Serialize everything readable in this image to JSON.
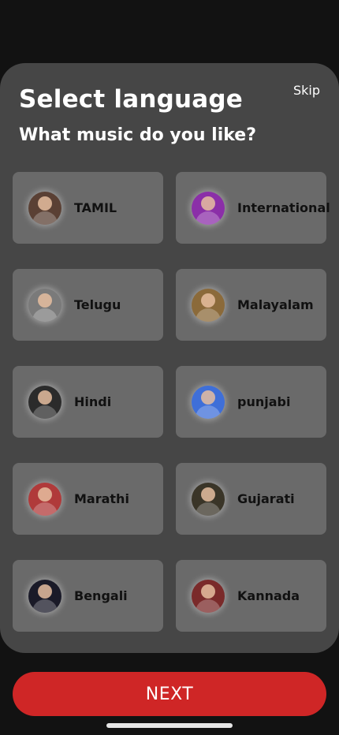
{
  "header": {
    "title": "Select language",
    "skip_label": "Skip",
    "subtitle": "What music do you like?"
  },
  "languages": [
    {
      "label": "TAMIL",
      "avatar_color": "#5a4034"
    },
    {
      "label": "International",
      "avatar_color": "#8b2fa8"
    },
    {
      "label": "Telugu",
      "avatar_color": "#7a7a7a"
    },
    {
      "label": "Malayalam",
      "avatar_color": "#8b6a3a"
    },
    {
      "label": "Hindi",
      "avatar_color": "#2b2b2b"
    },
    {
      "label": "punjabi",
      "avatar_color": "#3f6fd8"
    },
    {
      "label": "Marathi",
      "avatar_color": "#b03a3a"
    },
    {
      "label": "Gujarati",
      "avatar_color": "#3a3528"
    },
    {
      "label": "Bengali",
      "avatar_color": "#1a1a28"
    },
    {
      "label": "Kannada",
      "avatar_color": "#7a2a2a"
    }
  ],
  "footer": {
    "next_label": "NEXT"
  },
  "colors": {
    "accent": "#cf2626",
    "sheet_bg": "#464646",
    "card_bg": "#6a6a6a",
    "page_bg": "#121212"
  }
}
